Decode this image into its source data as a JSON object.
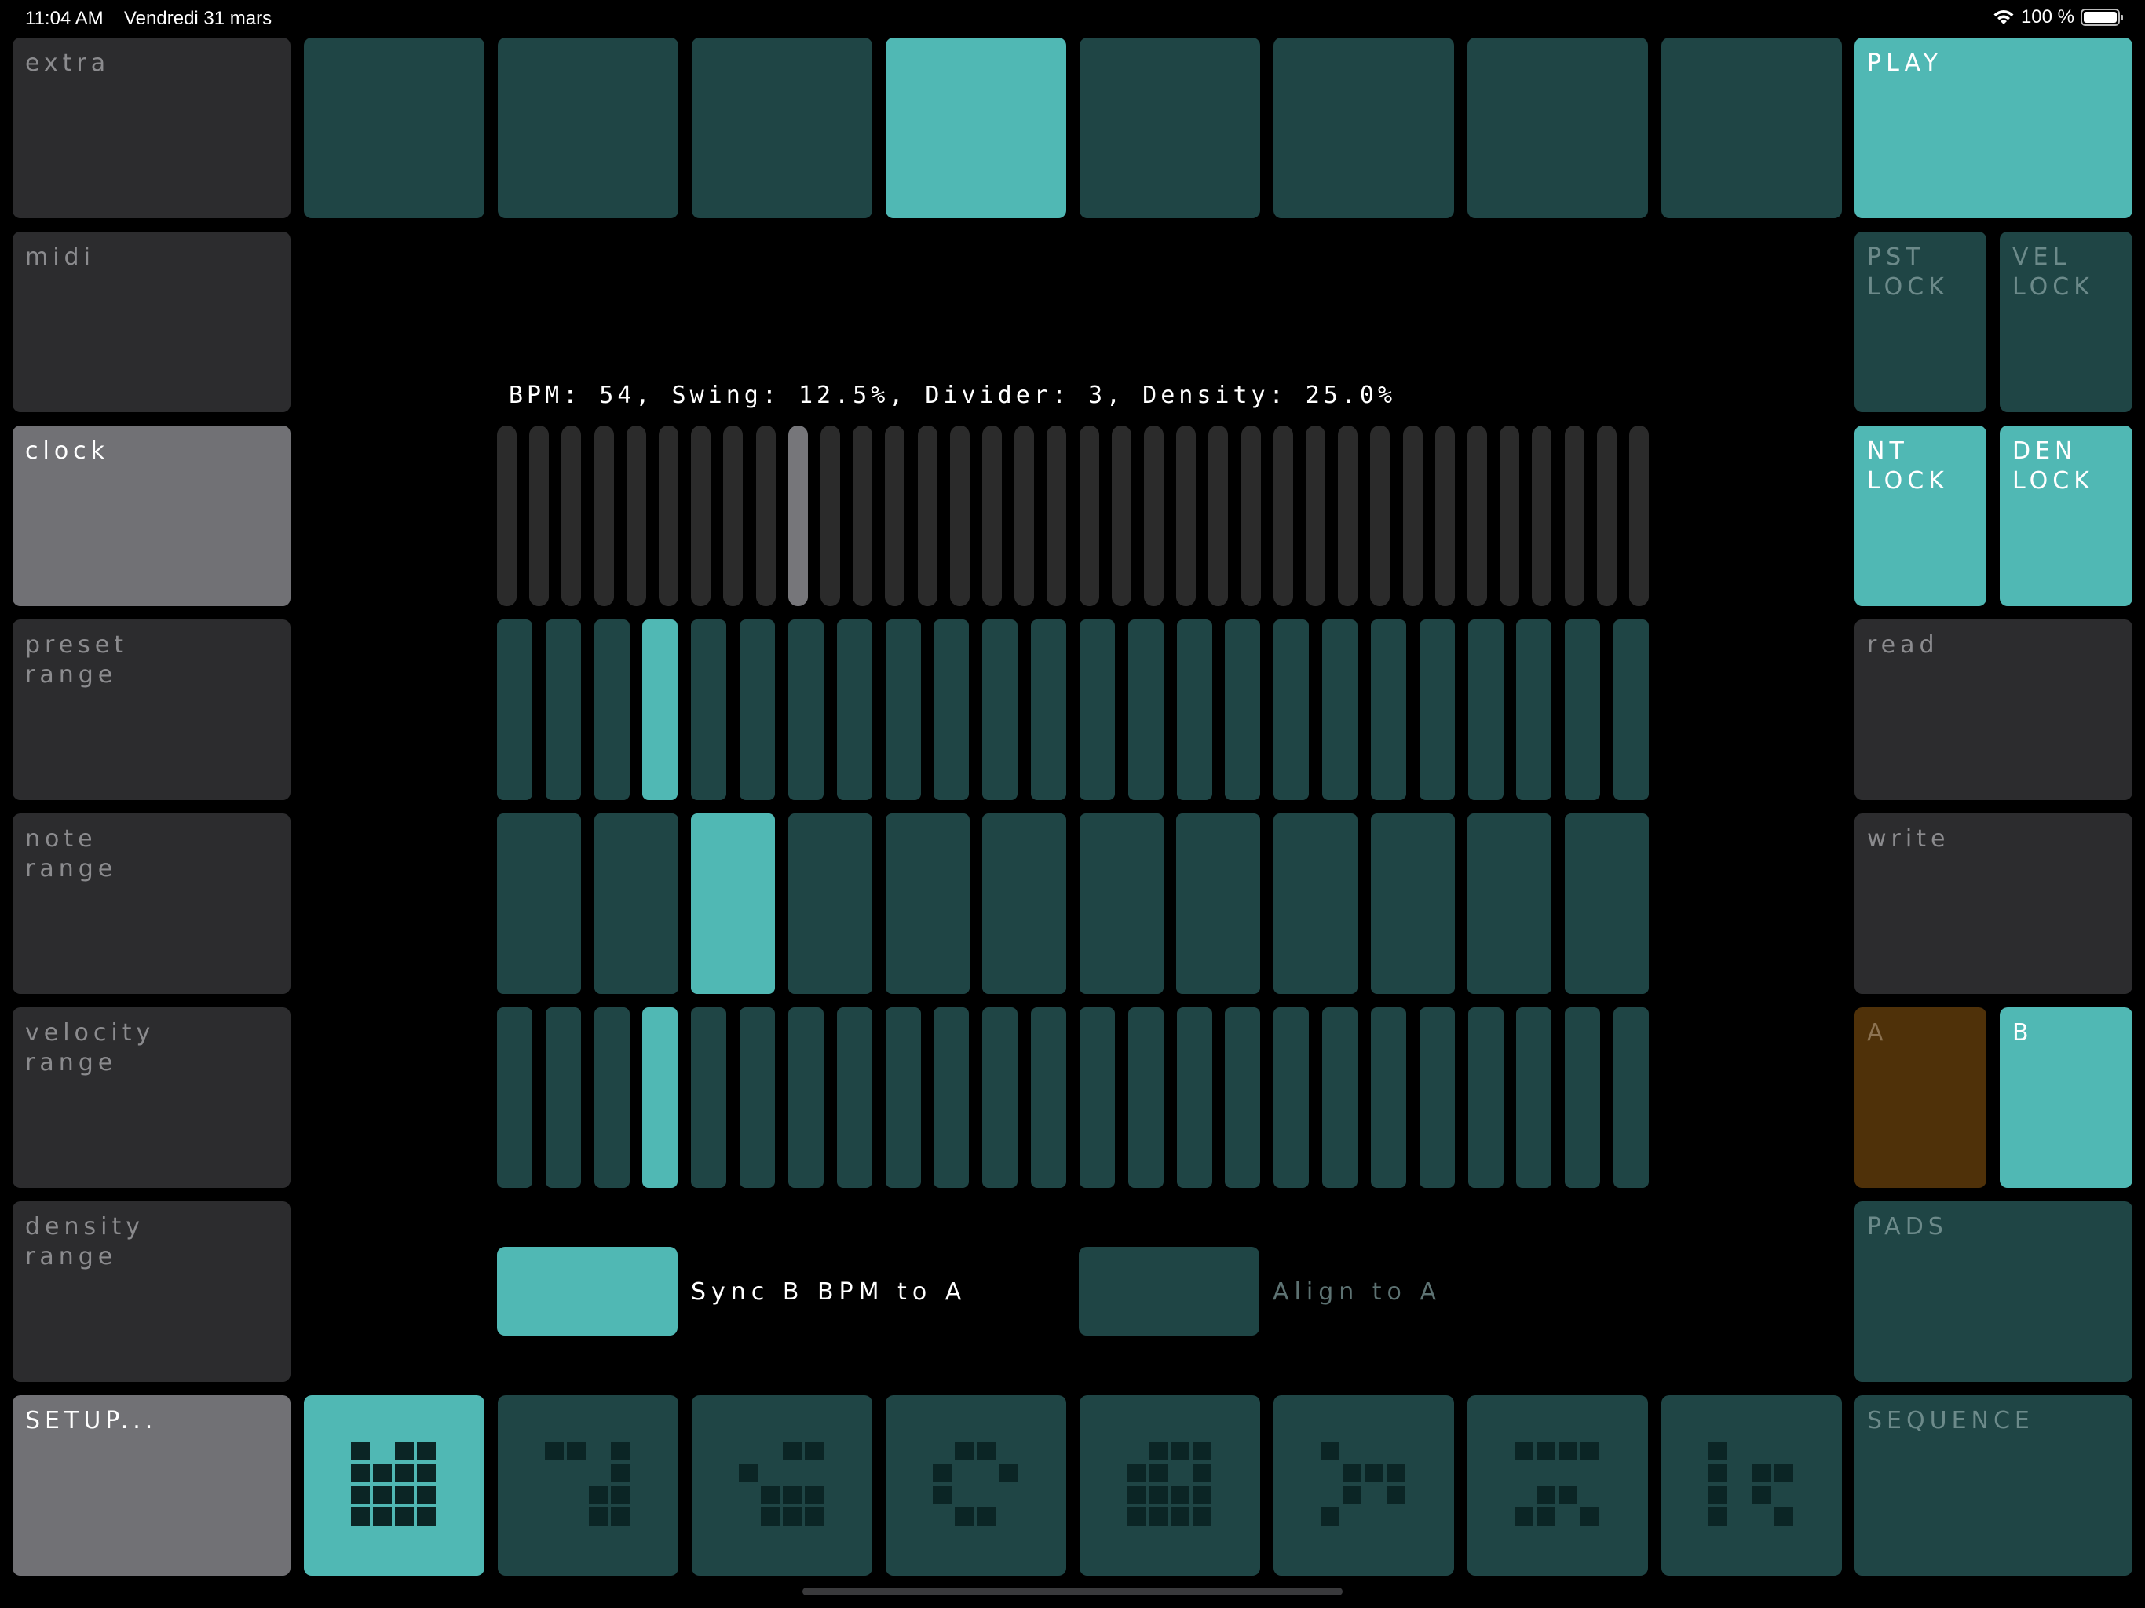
{
  "status_bar": {
    "time": "11:04 AM",
    "date": "Vendredi 31 mars",
    "battery": "100 %"
  },
  "left_column": {
    "extra": "extra",
    "midi": "midi",
    "clock": "clock",
    "preset_range": "preset\nrange",
    "note_range": "note\nrange",
    "velocity_range": "velocity\nrange",
    "density_range": "density\nrange",
    "setup": "SETUP..."
  },
  "right_column": {
    "play": "PLAY",
    "pst_lock": "PST\nLOCK",
    "vel_lock": "VEL\nLOCK",
    "nt_lock": "NT\nLOCK",
    "den_lock": "DEN\nLOCK",
    "read": "read",
    "write": "write",
    "a": "A",
    "b": "B",
    "pads": "PADS",
    "sequence": "SEQUENCE"
  },
  "top_row": {
    "count": 8,
    "active_index": 3
  },
  "main": {
    "info": "BPM: 54, Swing: 12.5%, Divider: 3, Density: 25.0%",
    "bpm": 54,
    "swing_percent": 12.5,
    "divider": 3,
    "density_percent": 25.0,
    "clock_bar_count": 36,
    "clock_active_index": 9,
    "sequence_row1": {
      "count": 24,
      "active_index": 3
    },
    "sequence_row2": {
      "count": 12,
      "active_index": 2
    },
    "sequence_row3": {
      "count": 24,
      "active_index": 3
    },
    "sync_button_label": "Sync B BPM to A",
    "sync_active": true,
    "align_button_label": "Align to A",
    "align_active": false
  },
  "bottom_row": {
    "active_index": 0,
    "glyphs": [
      [
        [
          1,
          0,
          1,
          1
        ],
        [
          1,
          1,
          1,
          1
        ],
        [
          1,
          1,
          1,
          1
        ],
        [
          1,
          1,
          1,
          1
        ]
      ],
      [
        [
          1,
          1,
          0,
          1
        ],
        [
          0,
          0,
          0,
          1
        ],
        [
          0,
          0,
          1,
          1
        ],
        [
          0,
          0,
          1,
          1
        ]
      ],
      [
        [
          0,
          0,
          1,
          1
        ],
        [
          1,
          0,
          0,
          0
        ],
        [
          0,
          1,
          1,
          1
        ],
        [
          0,
          1,
          1,
          1
        ]
      ],
      [
        [
          0,
          1,
          1,
          0
        ],
        [
          1,
          0,
          0,
          1
        ],
        [
          1,
          0,
          0,
          0
        ],
        [
          0,
          1,
          1,
          0
        ]
      ],
      [
        [
          0,
          1,
          1,
          1
        ],
        [
          1,
          1,
          0,
          1
        ],
        [
          1,
          1,
          1,
          1
        ],
        [
          1,
          1,
          1,
          1
        ]
      ],
      [
        [
          1,
          0,
          0,
          0
        ],
        [
          0,
          1,
          1,
          1
        ],
        [
          0,
          1,
          0,
          1
        ],
        [
          1,
          0,
          0,
          0
        ]
      ],
      [
        [
          1,
          1,
          1,
          1
        ],
        [
          0,
          0,
          0,
          0
        ],
        [
          0,
          1,
          1,
          0
        ],
        [
          1,
          1,
          0,
          1
        ]
      ],
      [
        [
          1,
          0,
          0,
          0
        ],
        [
          1,
          0,
          1,
          1
        ],
        [
          1,
          0,
          1,
          0
        ],
        [
          1,
          0,
          0,
          1
        ]
      ]
    ]
  },
  "colors": {
    "background": "#000000",
    "pad_gray": "#2c2c2e",
    "pad_gray_active": "#717175",
    "teal_dark": "#1f4545",
    "teal_bright": "#50b8b4",
    "brown": "#4f3109"
  }
}
